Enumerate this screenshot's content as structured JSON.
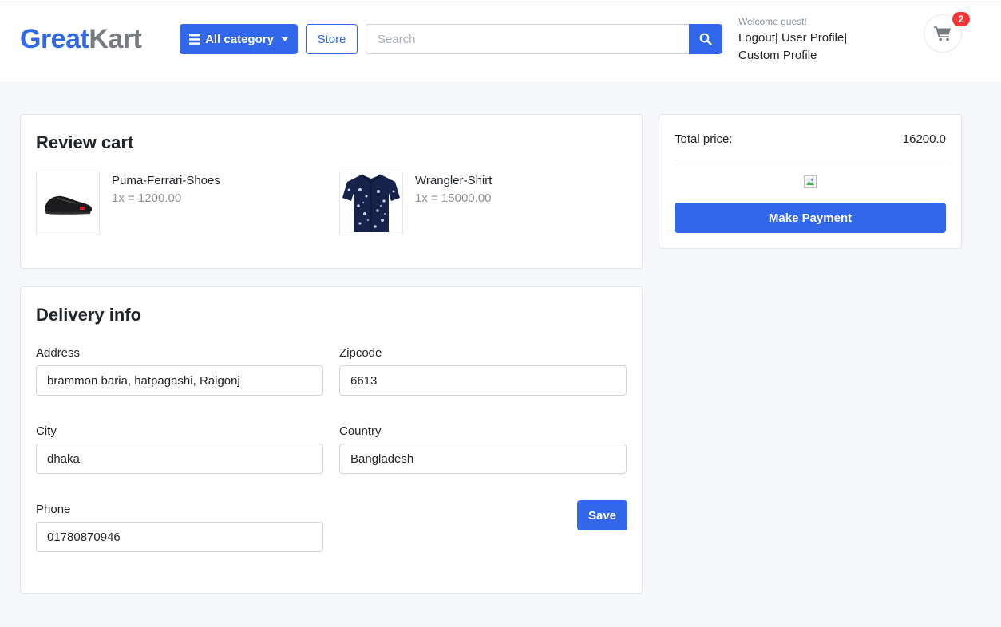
{
  "brand": {
    "logo_part1": "Great",
    "logo_part2": "Kart"
  },
  "header": {
    "category_label": "All category",
    "store_label": "Store",
    "search_placeholder": "Search",
    "welcome_text": "Welcome guest!",
    "logout_label": "Logout",
    "user_profile_label": "User Profile",
    "custom_profile_label": "Custom Profile",
    "separator": "|",
    "cart_count": "2"
  },
  "review": {
    "title": "Review cart",
    "items": [
      {
        "name": "Puma-Ferrari-Shoes",
        "price": "1x = 1200.00",
        "icon": "shoe-image"
      },
      {
        "name": "Wrangler-Shirt",
        "price": "1x = 15000.00",
        "icon": "shirt-image"
      }
    ]
  },
  "delivery": {
    "title": "Delivery info",
    "address_label": "Address",
    "address_value": "brammon baria, hatpagashi, Raigonj",
    "zipcode_label": "Zipcode",
    "zipcode_value": "6613",
    "city_label": "City",
    "city_value": "dhaka",
    "country_label": "Country",
    "country_value": "Bangladesh",
    "phone_label": "Phone",
    "phone_value": "01780870946",
    "save_label": "Save"
  },
  "summary": {
    "total_label": "Total price:",
    "total_value": "16200.0",
    "pay_label": "Make Payment"
  },
  "colors": {
    "primary": "#3167eb",
    "logo_gray": "#777b80",
    "badge": "#fa3434",
    "background": "#f5f7fa"
  }
}
